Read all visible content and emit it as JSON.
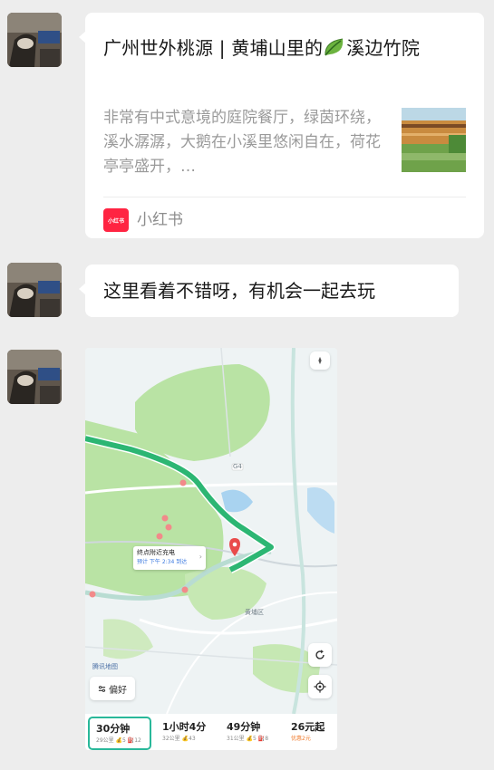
{
  "messages": [
    {
      "type": "link_card",
      "title": "广州世外桃源 | 黄埔山里的",
      "title_tail": "溪边竹院",
      "description": "非常有中式意境的庭院餐厅，绿茵环绕，溪水潺潺，大鹅在小溪里悠闲自在，荷花亭亭盛开，…",
      "source_icon_text": "小红书",
      "source_name": "小红书"
    },
    {
      "type": "text",
      "text": "这里看着不错呀，有机会一起去玩"
    },
    {
      "type": "map_screenshot",
      "pin_title": "终点附近充电",
      "pin_subtitle": "预计 下午 2:34 到达",
      "district_label": "黄埔区",
      "road_label": "G4",
      "preference_label": "偏好",
      "brand_mark": "腾讯地图",
      "routes": [
        {
          "time": "30分钟",
          "detail": "29公里 💰5 ⛽12",
          "selected": true
        },
        {
          "time": "1小时4分",
          "detail": "32公里 💰43",
          "selected": false
        },
        {
          "time": "49分钟",
          "detail": "31公里 💰5 ⛽8",
          "selected": false
        },
        {
          "time": "26元起",
          "detail": "优惠2元",
          "selected": false,
          "orange": true
        }
      ]
    }
  ],
  "icons": {
    "leaf": "leaf-emoji-icon",
    "refresh": "refresh-icon",
    "locate": "locate-icon",
    "compass": "compass-icon"
  },
  "colors": {
    "background": "#ededed",
    "bubble": "#ffffff",
    "xiaohongshu_red": "#ff2442",
    "route_green": "#2cb673",
    "map_park": "#b9e3a4"
  }
}
